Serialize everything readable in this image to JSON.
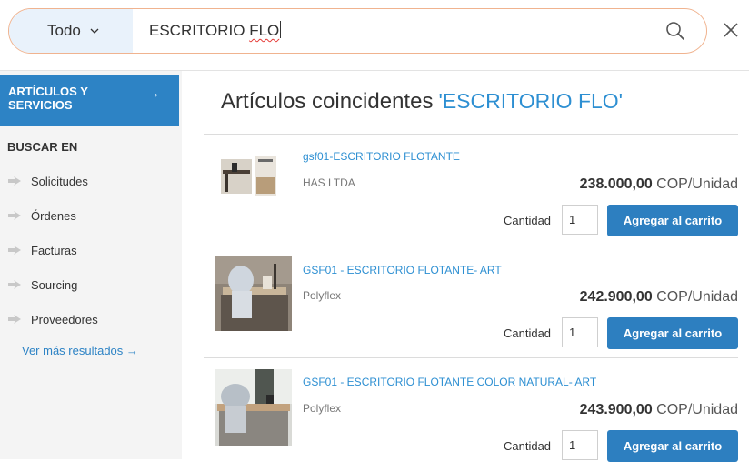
{
  "search": {
    "scope_label": "Todo",
    "query_text": "ESCRITORIO ",
    "query_misspelled": "FLO"
  },
  "sidebar": {
    "active_item": {
      "label": "ARTÍCULOS Y SERVICIOS",
      "arrow": "→"
    },
    "section_label": "BUSCAR EN",
    "items": [
      {
        "label": "Solicitudes"
      },
      {
        "label": "Órdenes"
      },
      {
        "label": "Facturas"
      },
      {
        "label": "Sourcing"
      },
      {
        "label": "Proveedores"
      }
    ],
    "more_link": "Ver más resultados →"
  },
  "main": {
    "title": "Artículos coincidentes",
    "query_echo": "'ESCRITORIO FLO'",
    "items": [
      {
        "name": "gsf01-ESCRITORIO FLOTANTE",
        "vendor": "HAS LTDA",
        "price": "238.000,00",
        "unit": "COP/Unidad",
        "qty_label": "Cantidad",
        "qty": "1",
        "add_label": "Agregar al carrito"
      },
      {
        "name": "GSF01 - ESCRITORIO FLOTANTE- ART",
        "vendor": "Polyflex",
        "price": "242.900,00",
        "unit": "COP/Unidad",
        "qty_label": "Cantidad",
        "qty": "1",
        "add_label": "Agregar al carrito"
      },
      {
        "name": "GSF01 - ESCRITORIO FLOTANTE COLOR NATURAL- ART",
        "vendor": "Polyflex",
        "price": "243.900,00",
        "unit": "COP/Unidad",
        "qty_label": "Cantidad",
        "qty": "1",
        "add_label": "Agregar al carrito"
      }
    ]
  },
  "colors": {
    "accent_blue": "#2d83c5",
    "link_blue": "#2d8fd2",
    "search_border": "#f0b38f"
  }
}
